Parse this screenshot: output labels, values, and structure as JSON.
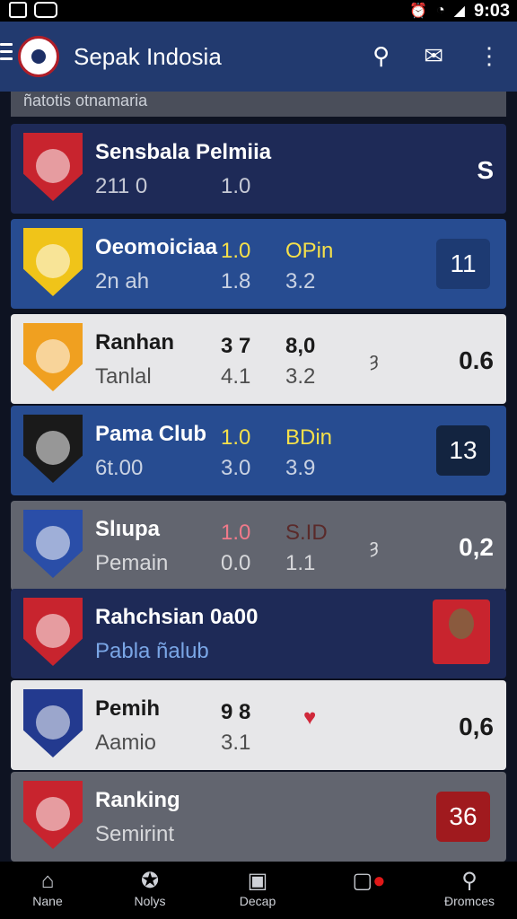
{
  "status": {
    "time": "9:03"
  },
  "header": {
    "title": "Sepak Indosia"
  },
  "subheader": {
    "text": "ñatotis otnamaria"
  },
  "rows": [
    {
      "name": "Sensbala Pelmiia",
      "second": "211 0",
      "v3": "1.0",
      "score": "S",
      "colors": {
        "bg": "#1e2a57",
        "badge": "#c8242e"
      }
    },
    {
      "name": "Oeomoiciaa",
      "v1": "1.0",
      "v2": "OPin",
      "second": "2n ah",
      "v3": "1.8",
      "v4": "3.2",
      "score": "11",
      "colors": {
        "bg": "#274c91",
        "badge": "#f0c419",
        "v_accent": "#f5e04a",
        "score_box": "#1d3a72"
      }
    },
    {
      "name": "Ranhan",
      "v1": "3 7",
      "v2": "8,0",
      "second": "Tanlal",
      "v3": "4.1",
      "v4": "3.2",
      "marker": "ȝ",
      "score": "0.6",
      "colors": {
        "bg": "#e7e7e9",
        "badge": "#f0a020"
      }
    },
    {
      "name": "Pama Club",
      "v1": "1.0",
      "v2": "BDin",
      "second": "6t.00",
      "v3": "3.0",
      "v4": "3.9",
      "score": "13",
      "colors": {
        "bg": "#274c91",
        "badge": "#1a1a1a",
        "v_accent": "#f5e04a",
        "score_box": "#132440"
      }
    },
    {
      "name": "Slıupa",
      "v1": "1.0",
      "v2": "S.ID",
      "second": "Pemain",
      "v3": "0.0",
      "v4": "1.1",
      "marker": "ȝ",
      "score": "0,2",
      "colors": {
        "bg": "#62656f",
        "badge": "#2a4ea8",
        "v1_color": "#f07a8a",
        "v2_color": "#5a2a2a"
      }
    },
    {
      "name": "Rahchsian 0a00",
      "second": "Pabla ñalub",
      "colors": {
        "bg": "#1e2a57",
        "badge": "#c8242e",
        "second_color": "#7aa6e6"
      }
    },
    {
      "name": "Pemih",
      "v1": "9 8",
      "v3": "3.1",
      "second": "Aamio",
      "score": "0,6",
      "colors": {
        "bg": "#e7e7e9",
        "badge": "#233a8f"
      }
    },
    {
      "name": "Ranking",
      "second": "Semirint",
      "score": "36",
      "colors": {
        "bg": "#62656f",
        "badge": "#c8242e",
        "score_box": "#a01a1e"
      }
    }
  ],
  "nav": [
    {
      "label": "Nane",
      "icon": "home-icon"
    },
    {
      "label": "Nolys",
      "icon": "star-icon"
    },
    {
      "label": "Decap",
      "icon": "chat-icon"
    },
    {
      "label": "",
      "icon": "live-icon"
    },
    {
      "label": "Ðromces",
      "icon": "search-icon"
    }
  ]
}
